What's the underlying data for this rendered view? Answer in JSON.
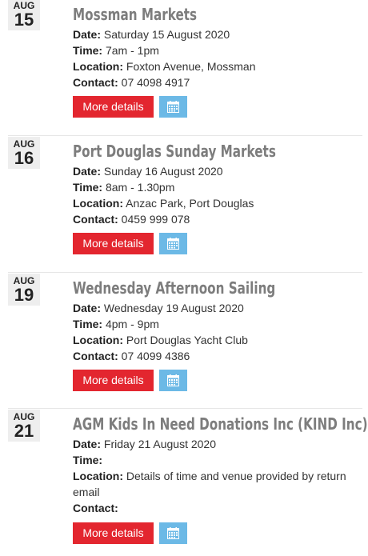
{
  "labels": {
    "date": "Date:",
    "time": "Time:",
    "location": "Location:",
    "contact": "Contact:",
    "more_details": "More details"
  },
  "colors": {
    "button_red": "#e3262f",
    "button_blue": "#6cb9e6",
    "title_grey": "#7d7d7d",
    "badge_bg": "#eeeeee"
  },
  "icons": {
    "calendar_button": "calendar-icon"
  },
  "events": [
    {
      "month": "AUG",
      "day": "15",
      "title": "Mossman Markets",
      "date": "Saturday 15 August 2020",
      "time": "7am - 1pm",
      "location": "Foxton Avenue, Mossman",
      "contact": "07 4098 4917"
    },
    {
      "month": "AUG",
      "day": "16",
      "title": "Port Douglas Sunday Markets",
      "date": "Sunday 16 August 2020",
      "time": "8am - 1.30pm",
      "location": "Anzac Park, Port Douglas",
      "contact": "0459 999 078"
    },
    {
      "month": "AUG",
      "day": "19",
      "title": "Wednesday Afternoon Sailing",
      "date": "Wednesday 19 August 2020",
      "time": "4pm - 9pm",
      "location": "Port Douglas Yacht Club",
      "contact": "07 4099 4386"
    },
    {
      "month": "AUG",
      "day": "21",
      "title": "AGM Kids In Need Donations Inc (KIND Inc)",
      "date": "Friday 21 August 2020",
      "time": "",
      "location": "Details of time and venue provided by return email",
      "contact": ""
    }
  ]
}
